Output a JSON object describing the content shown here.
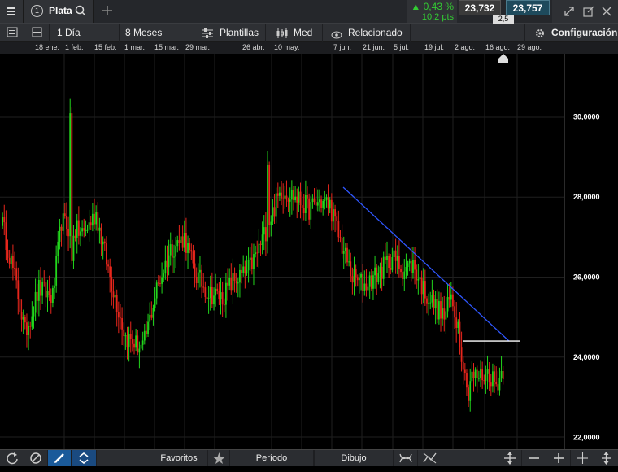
{
  "header": {
    "tab_number": "1",
    "instrument": "Plata",
    "change_percent": "▲ 0,43 %",
    "change_points": "10,2 pts",
    "sell_price": "23,732",
    "spread": "2,5",
    "buy_price": "23,757"
  },
  "toolbar": {
    "interval": "1 Día",
    "range": "8 Meses",
    "templates": "Plantillas",
    "price_type": "Med",
    "related": "Relacionado",
    "settings": "Configuración"
  },
  "date_axis": [
    "18 ene.",
    "1 feb.",
    "15 feb.",
    "1 mar.",
    "15 mar.",
    "29 mar.",
    "26 abr.",
    "10 may.",
    "7 jun.",
    "21 jun.",
    "5 jul.",
    "19 jul.",
    "2 ago.",
    "16 ago.",
    "29 ago."
  ],
  "bottom_bar": {
    "favorites": "Favoritos",
    "period": "Período",
    "drawing": "Dibujo"
  },
  "colors": {
    "up": "#22d61c",
    "down": "#e8261c",
    "trendline": "#2f57ff",
    "sell_bg": "#3a3a3a",
    "buy_bg": "#1e4a5c",
    "positive_text": "#33cc33"
  },
  "chart_data": {
    "type": "candlestick",
    "instrument": "Plata",
    "yticks": [
      "30,0000",
      "28,0000",
      "26,0000",
      "24,0000",
      "22,0000"
    ],
    "ylim": [
      21.8,
      31.5
    ],
    "xlabels": [
      "18 ene.",
      "1 feb.",
      "15 feb.",
      "1 mar.",
      "15 mar.",
      "29 mar.",
      "26 abr.",
      "10 may.",
      "7 jun.",
      "21 jun.",
      "5 jul.",
      "19 jul.",
      "2 ago.",
      "16 ago.",
      "29 ago."
    ],
    "trendline": {
      "start": [
        "2 jun.",
        28.25
      ],
      "end": [
        "23 ago.",
        24.4
      ]
    },
    "horizontal_line": {
      "start": [
        "4 ago.",
        24.4
      ],
      "end": [
        "26 ago.",
        24.4
      ],
      "value": 24.4
    },
    "last_price_approx": 23.75
  }
}
